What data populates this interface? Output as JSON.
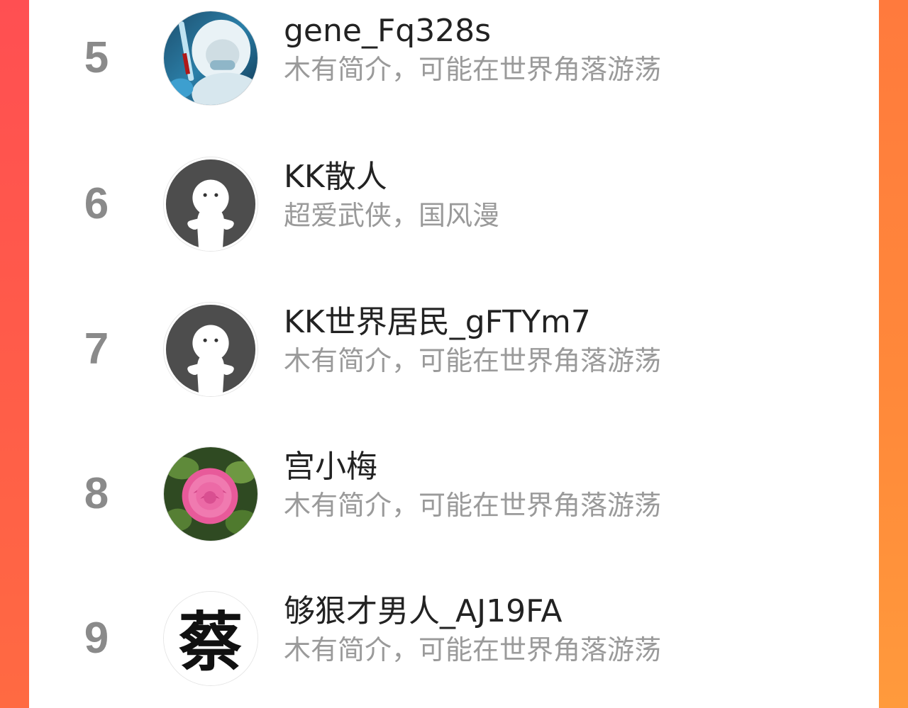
{
  "users": [
    {
      "rank": "5",
      "name": "gene_Fq328s",
      "bio": "木有简介，可能在世界角落游荡",
      "avatar_icon": "medical-researcher-photo"
    },
    {
      "rank": "6",
      "name": "KK散人",
      "bio": "超爱武侠，国风漫",
      "avatar_icon": "default-ghost-avatar"
    },
    {
      "rank": "7",
      "name": "KK世界居民_gFTYm7",
      "bio": "木有简介，可能在世界角落游荡",
      "avatar_icon": "default-ghost-avatar"
    },
    {
      "rank": "8",
      "name": "宫小梅",
      "bio": "木有简介，可能在世界角落游荡",
      "avatar_icon": "pink-rose-photo"
    },
    {
      "rank": "9",
      "name": "够狠才男人_AJ19FA",
      "bio": "木有简介，可能在世界角落游荡",
      "avatar_icon": "calligraphy-character-avatar",
      "avatar_text": "蔡"
    }
  ],
  "colors": {
    "frame_left": "#ff5a4a",
    "frame_right": "#ff8a3a",
    "rank": "#8a8a8a",
    "name": "#222222",
    "bio": "#9a9a9a"
  }
}
